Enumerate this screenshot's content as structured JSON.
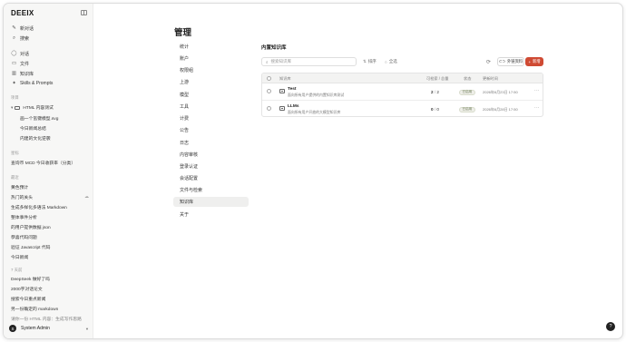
{
  "app": {
    "logo": "DEEIX"
  },
  "sidebar": {
    "nav": [
      {
        "icon": "compose-icon",
        "glyph": "✎",
        "label": "新对话"
      },
      {
        "icon": "search-icon",
        "glyph": "⌕",
        "label": "搜索"
      }
    ],
    "nav2": [
      {
        "icon": "chat-icon",
        "glyph": "◯",
        "label": "对话"
      },
      {
        "icon": "document-icon",
        "glyph": "▭",
        "label": "文件"
      },
      {
        "icon": "book-icon",
        "glyph": "▥",
        "label": "知识库"
      },
      {
        "icon": "sparkle-icon",
        "glyph": "✦",
        "label": "Skills & Prompts"
      }
    ],
    "projects_label": "项目",
    "project": {
      "name": "HTML 内容测试"
    },
    "project_items": [
      "画一个氢键模型.svg",
      "今日新闻总结",
      "内建的文化逆袭"
    ],
    "starred_label": "星标",
    "starred_items": [
      "查询币 MCD 今日收获率（分类）"
    ],
    "recent_label": "最近",
    "recent_items": [
      "黄色预计",
      "热门的关头",
      "生成多样化多语法 Markdown",
      "整体事件分析",
      "的用户提供数据 json",
      "恭喜代码问题",
      "验证 Javascript 代码",
      "今日新闻"
    ],
    "earlier_label": "7 天前",
    "earlier_items": [
      "DeepSeek 做好了吗",
      "2000字对话论文",
      "搜索今日重点新闻",
      "另一份确定的 markdown",
      "请你一份 HTML 内容：生成写作思路"
    ],
    "user": {
      "initial": "S",
      "name": "System Admin"
    }
  },
  "settings": {
    "title": "管理",
    "nav": [
      "统计",
      "账户",
      "权限组",
      "上游",
      "模型",
      "工具",
      "计费",
      "公告",
      "日志",
      "内容审核",
      "登录认证",
      "会话配置",
      "文件与检索",
      "知识库",
      "关于"
    ],
    "active_index": 13
  },
  "kb": {
    "title": "内置知识库",
    "search_placeholder": "搜索知识库",
    "filter_sort": "排序",
    "filter_all": "全选",
    "btn_import": "外链资料",
    "btn_new": "新增",
    "columns": {
      "name": "知识库",
      "docs": "可检索 / 总量",
      "status": "状态",
      "updated": "更新时间"
    },
    "rows": [
      {
        "name": "Test",
        "desc": "面向所有用户提供的内置知识库测试",
        "indexed": "2",
        "total": "2",
        "status": "已启用",
        "updated": "2026年6月23日 17:50"
      },
      {
        "name": "LLMs",
        "desc": "面向所有用户开放的大模型知识库",
        "indexed": "0",
        "total": "0",
        "status": "已启用",
        "updated": "2026年6月28日 17:50"
      }
    ]
  },
  "help": {
    "label": "?"
  }
}
